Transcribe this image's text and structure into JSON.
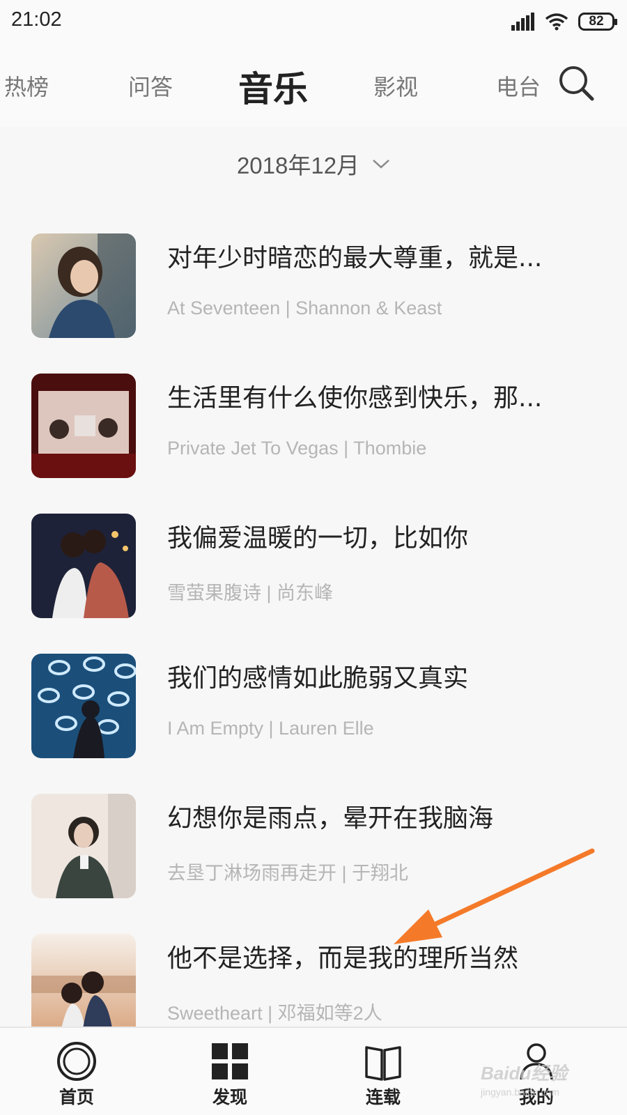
{
  "status_bar": {
    "time": "21:02",
    "battery": "82"
  },
  "tabs": [
    {
      "label": "热榜",
      "active": false
    },
    {
      "label": "问答",
      "active": false
    },
    {
      "label": "音乐",
      "active": true
    },
    {
      "label": "影视",
      "active": false
    },
    {
      "label": "电台",
      "active": false
    }
  ],
  "search": {
    "icon": "search-icon"
  },
  "month_selector": {
    "label": "2018年12月",
    "icon": "chevron-down-icon"
  },
  "items": [
    {
      "title": "对年少时暗恋的最大尊重，就是...",
      "subtitle": "At Seventeen | Shannon & Keast"
    },
    {
      "title": "生活里有什么使你感到快乐，那...",
      "subtitle": "Private Jet To Vegas | Thombie"
    },
    {
      "title": "我偏爱温暖的一切，比如你",
      "subtitle": "雪萤果腹诗 | 尚东峰"
    },
    {
      "title": "我们的感情如此脆弱又真实",
      "subtitle": "I Am Empty | Lauren Elle"
    },
    {
      "title": "幻想你是雨点，晕开在我脑海",
      "subtitle": "去垦丁淋场雨再走开 | 于翔北"
    },
    {
      "title": "他不是选择，而是我的理所当然",
      "subtitle": "Sweetheart | 邓福如等2人"
    }
  ],
  "annotation": {
    "color": "#f47a2a",
    "icon": "arrow-icon"
  },
  "bottom_nav": [
    {
      "label": "首页",
      "icon": "home-circle-icon"
    },
    {
      "label": "发现",
      "icon": "grid-icon"
    },
    {
      "label": "连载",
      "icon": "book-icon"
    },
    {
      "label": "我的",
      "icon": "user-icon"
    }
  ],
  "watermark": {
    "text": "Baidu经验",
    "url": "jingyan.baidu.com"
  }
}
